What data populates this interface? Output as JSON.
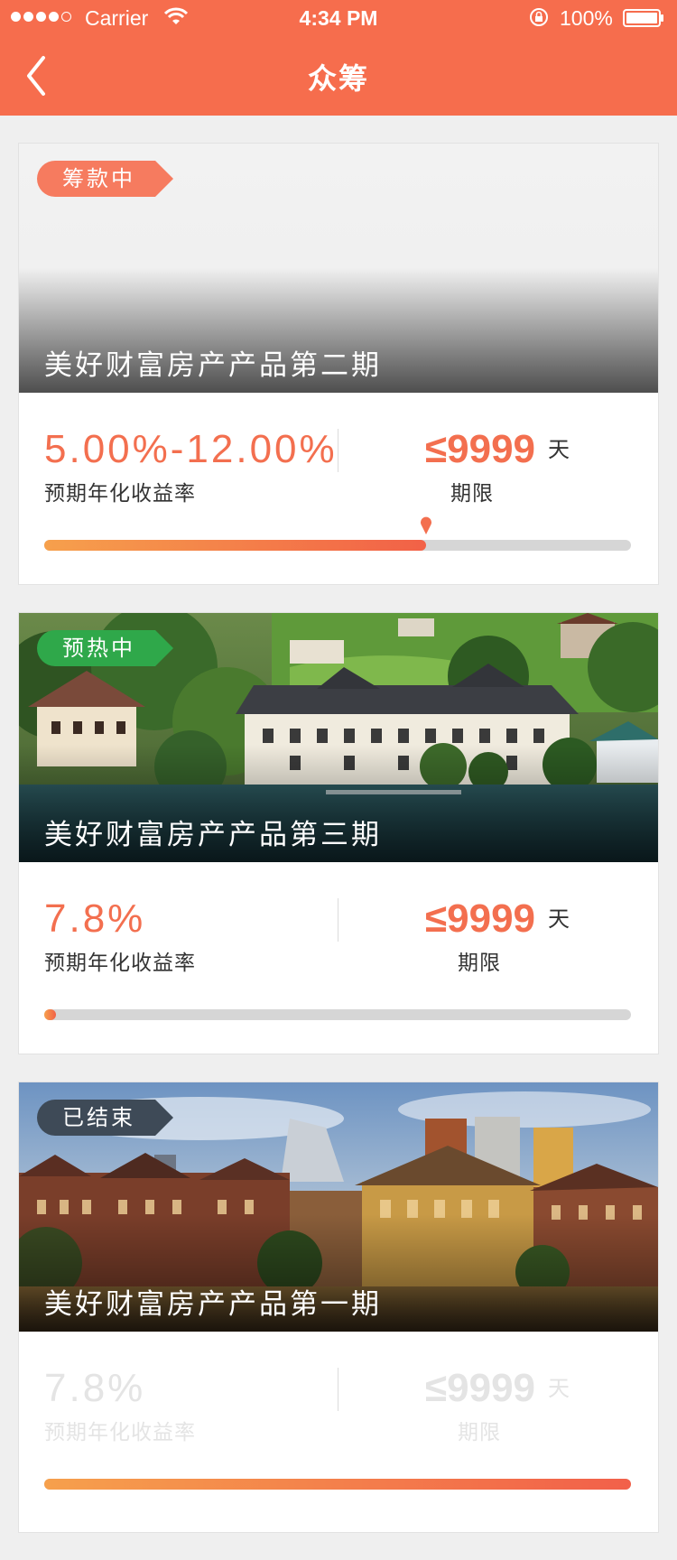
{
  "status_bar": {
    "carrier": "Carrier",
    "time": "4:34 PM",
    "battery": "100%"
  },
  "nav": {
    "title": "众筹"
  },
  "cards": [
    {
      "tag": "筹款中",
      "title": "美好财富房产产品第二期",
      "rate": "5.00%-12.00%",
      "rate_label": "预期年化收益率",
      "term": "≤9999",
      "term_unit": "天",
      "term_label": "期限",
      "progress": 0.65
    },
    {
      "tag": "预热中",
      "title": "美好财富房产产品第三期",
      "rate": "7.8%",
      "rate_label": "预期年化收益率",
      "term": "≤9999",
      "term_unit": "天",
      "term_label": "期限",
      "progress": 0.02
    },
    {
      "tag": "已结束",
      "title": "美好财富房产产品第一期",
      "rate": "7.8%",
      "rate_label": "预期年化收益率",
      "term": "≤9999",
      "term_unit": "天",
      "term_label": "期限",
      "progress": 1.0
    }
  ],
  "colors": {
    "brand": "#f66d4d",
    "accent_text": "#f36f4f",
    "tag_raising": "#f67b5f",
    "tag_preheat": "#2fa84a",
    "tag_ended": "#3e4a57"
  }
}
